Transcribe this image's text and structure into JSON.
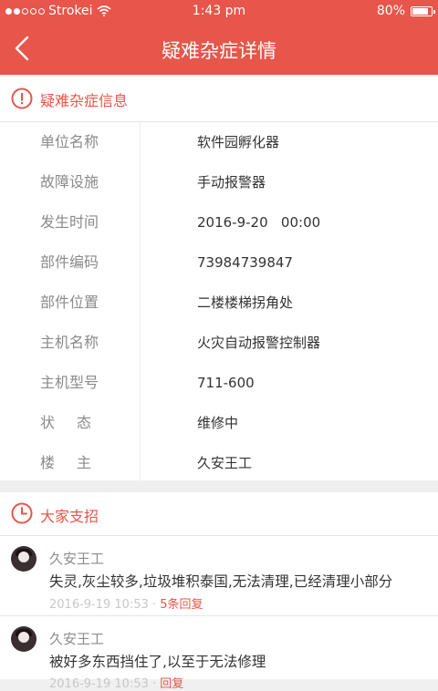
{
  "status_bar": {
    "carrier": "Strokei",
    "time": "1:43 pm",
    "battery": "80%"
  },
  "nav": {
    "title": "疑难杂症详情"
  },
  "info_section": {
    "title": "疑难杂症信息",
    "rows": [
      {
        "key": "单位名称",
        "value": "软件园孵化器"
      },
      {
        "key": "故障设施",
        "value": "手动报警器"
      },
      {
        "key": "发生时间",
        "value": "2016-9-20   00:00"
      },
      {
        "key": "部件编码",
        "value": "73984739847"
      },
      {
        "key": "部件位置",
        "value": "二楼楼梯拐角处"
      },
      {
        "key": "主机名称",
        "value": "火灾自动报警控制器"
      },
      {
        "key": "主机型号",
        "value": "711-600"
      },
      {
        "key": "状态",
        "value": "维修中"
      },
      {
        "key": "楼主",
        "value": "久安王工"
      }
    ]
  },
  "advice_section": {
    "title": "大家支招",
    "comments": [
      {
        "name": "久安王工",
        "text": "失灵,灰尘较多,垃圾堆积泰国,无法清理,已经清理小部分",
        "time": "2016-9-19 10:53",
        "replies": "5条回复"
      },
      {
        "name": "久安王工",
        "text": "被好多东西挡住了,以至于无法修理",
        "time": "2016-9-19 10:53",
        "replies": "回复"
      }
    ]
  },
  "colors": {
    "accent": "#e8554a"
  }
}
